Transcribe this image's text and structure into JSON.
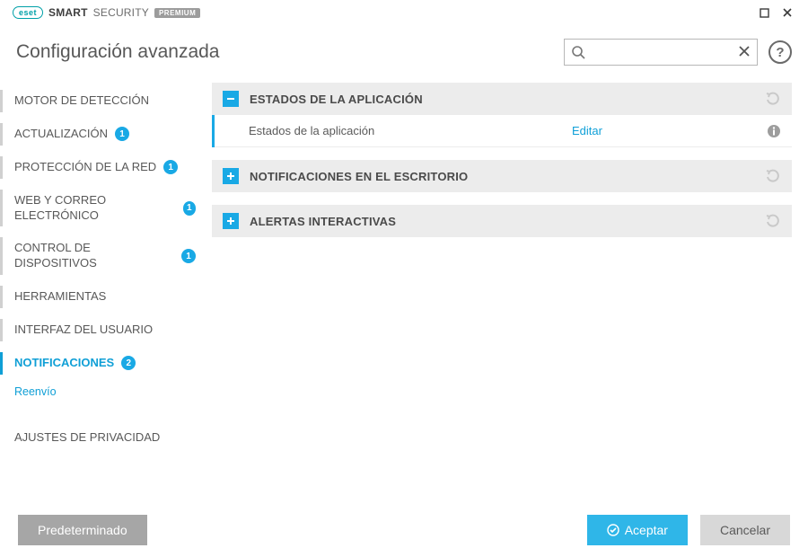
{
  "brand": {
    "logo_text": "eset",
    "name_strong": "SMART",
    "name_light": "SECURITY",
    "badge": "PREMIUM"
  },
  "window_controls": {
    "maximize_icon": "maximize-icon",
    "close_icon": "close-icon"
  },
  "header": {
    "title": "Configuración avanzada",
    "search_placeholder": "",
    "help_symbol": "?"
  },
  "sidebar": {
    "items": [
      {
        "label": "MOTOR DE DETECCIÓN",
        "badge": null,
        "active": false
      },
      {
        "label": "ACTUALIZACIÓN",
        "badge": "1",
        "active": false
      },
      {
        "label": "PROTECCIÓN DE LA RED",
        "badge": "1",
        "active": false
      },
      {
        "label": "WEB Y CORREO ELECTRÓNICO",
        "badge": "1",
        "active": false
      },
      {
        "label": "CONTROL DE DISPOSITIVOS",
        "badge": "1",
        "active": false
      },
      {
        "label": "HERRAMIENTAS",
        "badge": null,
        "active": false
      },
      {
        "label": "INTERFAZ DEL USUARIO",
        "badge": null,
        "active": false
      },
      {
        "label": "NOTIFICACIONES",
        "badge": "2",
        "active": true
      },
      {
        "label": "AJUSTES DE PRIVACIDAD",
        "badge": null,
        "active": false
      }
    ],
    "sub": {
      "label": "Reenvío"
    }
  },
  "sections": [
    {
      "title": "ESTADOS DE LA APLICACIÓN",
      "expanded": true,
      "rows": [
        {
          "label": "Estados de la aplicación",
          "link": "Editar"
        }
      ]
    },
    {
      "title": "NOTIFICACIONES EN EL ESCRITORIO",
      "expanded": false,
      "rows": []
    },
    {
      "title": "ALERTAS INTERACTIVAS",
      "expanded": false,
      "rows": []
    }
  ],
  "footer": {
    "default": "Predeterminado",
    "accept": "Aceptar",
    "cancel": "Cancelar"
  }
}
